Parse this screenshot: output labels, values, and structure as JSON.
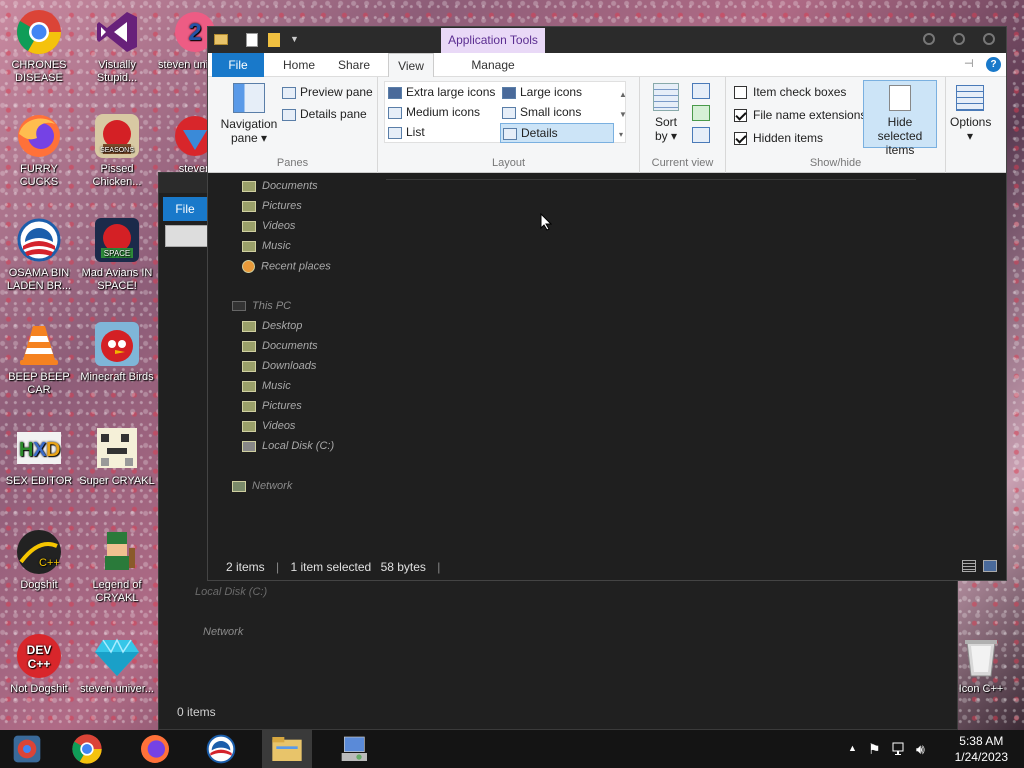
{
  "desktop": {
    "icons": [
      {
        "label": "CHRONES DISEASE",
        "icon": "chrome-icon"
      },
      {
        "label": "Visually Stupid...",
        "icon": "visual-studio-icon"
      },
      {
        "label": "steven univer...",
        "icon": "steven-universe-icon"
      },
      {
        "label": "FURRY CUCKS",
        "icon": "firefox-icon"
      },
      {
        "label": "Pissed Chicken...",
        "icon": "angry-birds-seasons-icon"
      },
      {
        "label": "steven",
        "icon": "gem-icon"
      },
      {
        "label": "OSAMA BIN LADEN BR...",
        "icon": "obama-logo-icon"
      },
      {
        "label": "Mad Avians IN SPACE!",
        "icon": "angry-birds-space-icon"
      },
      {
        "label": "BEEP BEEP CAR",
        "icon": "vlc-cone-icon"
      },
      {
        "label": "Minecraft Birds",
        "icon": "angry-bird-icon"
      },
      {
        "label": "SEX EDITOR",
        "icon": "hxd-icon"
      },
      {
        "label": "Super CRYAKL",
        "icon": "pixel-dog-icon"
      },
      {
        "label": "Dogshit",
        "icon": "codeblocks-icon"
      },
      {
        "label": "Legend of CRYAKL",
        "icon": "pixel-hero-icon"
      },
      {
        "label": "Not Dogshit",
        "icon": "dev-cpp-icon"
      },
      {
        "label": "steven univer...",
        "icon": "diamond-icon"
      },
      {
        "label": "Icon C++",
        "icon": "recycle-bin-icon"
      }
    ]
  },
  "background_window": {
    "file_tab": "File",
    "tree": [
      "Local Disk (C:)",
      "Network"
    ],
    "status": "0 items"
  },
  "window": {
    "context_tab": "Application Tools",
    "tabs": [
      "File",
      "Home",
      "Share",
      "View",
      "Manage"
    ],
    "panes_group": {
      "name": "Panes",
      "navigation_pane": "Navigation pane",
      "preview_pane": "Preview pane",
      "details_pane": "Details pane"
    },
    "layout_group": {
      "name": "Layout",
      "items": [
        "Extra large icons",
        "Large icons",
        "Medium icons",
        "Small icons",
        "List",
        "Details"
      ],
      "selected": "Details"
    },
    "current_view_group": {
      "name": "Current view",
      "sort_by": "Sort by"
    },
    "showhide_group": {
      "name": "Show/hide",
      "item_check_boxes": {
        "label": "Item check boxes",
        "checked": false
      },
      "file_name_extensions": {
        "label": "File name extensions",
        "checked": true
      },
      "hidden_items": {
        "label": "Hidden items",
        "checked": true
      },
      "hide_selected": "Hide selected items"
    },
    "options": "Options",
    "tree": {
      "quick": [
        "Documents",
        "Pictures",
        "Videos",
        "Music",
        "Recent places"
      ],
      "this_pc": "This PC",
      "pc_items": [
        "Desktop",
        "Documents",
        "Downloads",
        "Music",
        "Pictures",
        "Videos",
        "Local Disk (C:)"
      ],
      "network": "Network"
    },
    "status": {
      "items": "2 items",
      "selected": "1 item selected",
      "size": "58 bytes"
    }
  },
  "taskbar": {
    "time": "5:38 AM",
    "date": "1/24/2023",
    "apps": [
      "chrome-icon",
      "chrome-icon",
      "firefox-icon",
      "obama-logo-icon",
      "file-explorer-icon",
      "installer-icon"
    ]
  },
  "colors": {
    "accent": "#1979ca",
    "context_tab_bg": "#e9d9f7",
    "dark_bg": "#1f1f1f"
  }
}
